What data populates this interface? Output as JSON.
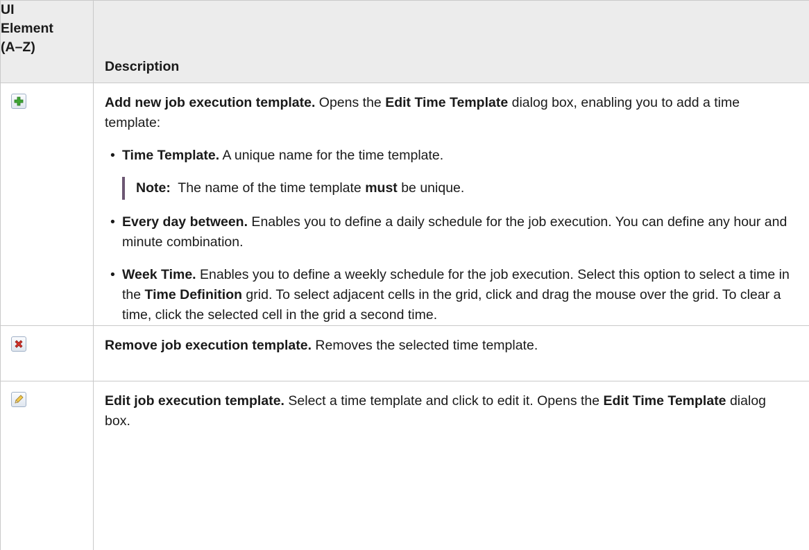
{
  "header": {
    "element_lines": [
      "UI",
      "Element",
      "(A–Z)"
    ],
    "description": "Description"
  },
  "rows": [
    {
      "icon": "add-icon",
      "intro": {
        "title": "Add new job execution template.",
        "t1": " Opens the ",
        "b1": "Edit Time Template",
        "t2": " dialog box, enabling you to add a time template:"
      },
      "bullets": [
        {
          "title": "Time Template.",
          "text": " A unique name for the time template."
        },
        {
          "title": "Every day between.",
          "text": " Enables you to define a daily schedule for the job execution. You can define any hour and minute combination."
        },
        {
          "title": "Week Time.",
          "t1": " Enables you to define a weekly schedule for the job execution. Select this option to select a time in the ",
          "b1": "Time Definition",
          "t2": " grid. To select adjacent cells in the grid, click and drag the mouse over the grid. To clear a time, click the selected cell in the grid a second time."
        }
      ],
      "note": {
        "label": "Note:",
        "t1": "  The name of the time template ",
        "b1": "must",
        "t2": " be unique."
      }
    },
    {
      "icon": "remove-icon",
      "title": "Remove job execution template.",
      "text": " Removes the selected time template."
    },
    {
      "icon": "edit-icon",
      "title": "Edit job execution template.",
      "t1": " Select a time template and click to edit it. Opens the ",
      "b1": "Edit Time Template",
      "t2": " dialog box."
    }
  ],
  "colors": {
    "header_bg": "#ececec",
    "border": "#c9c9c9",
    "note_bar": "#6c5773",
    "add_green": "#3fa535",
    "remove_red": "#d3322a"
  }
}
